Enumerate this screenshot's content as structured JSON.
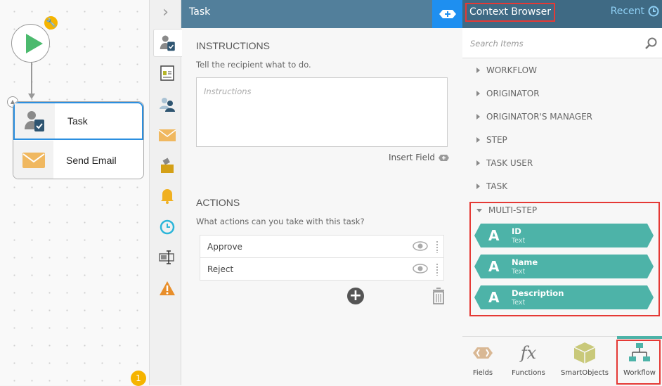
{
  "canvas": {
    "steps": [
      {
        "label": "Task"
      },
      {
        "label": "Send Email"
      }
    ],
    "badge_count": "1"
  },
  "task_panel": {
    "title": "Task",
    "instructions": {
      "heading": "INSTRUCTIONS",
      "subtitle": "Tell the recipient what to do.",
      "placeholder": "Instructions",
      "insert_field": "Insert Field"
    },
    "actions": {
      "heading": "ACTIONS",
      "subtitle": "What actions can you take with this task?",
      "items": [
        {
          "label": "Approve"
        },
        {
          "label": "Reject"
        }
      ]
    }
  },
  "context_browser": {
    "title": "Context Browser",
    "recent": "Recent",
    "search_placeholder": "Search Items",
    "nodes": [
      "WORKFLOW",
      "ORIGINATOR",
      "ORIGINATOR'S MANAGER",
      "STEP",
      "TASK USER",
      "TASK"
    ],
    "expanded": {
      "label": "MULTI-STEP",
      "items": [
        {
          "name": "ID",
          "type": "Text",
          "glyph": "A"
        },
        {
          "name": "Name",
          "type": "Text",
          "glyph": "A"
        },
        {
          "name": "Description",
          "type": "Text",
          "glyph": "A"
        }
      ]
    },
    "tabs": [
      {
        "label": "Fields"
      },
      {
        "label": "Functions"
      },
      {
        "label": "SmartObjects"
      },
      {
        "label": "Workflow"
      }
    ]
  },
  "colors": {
    "header": "#527f9b",
    "accent_blue": "#1e8ff0",
    "teal": "#4db3a8",
    "highlight_red": "#e53935"
  }
}
